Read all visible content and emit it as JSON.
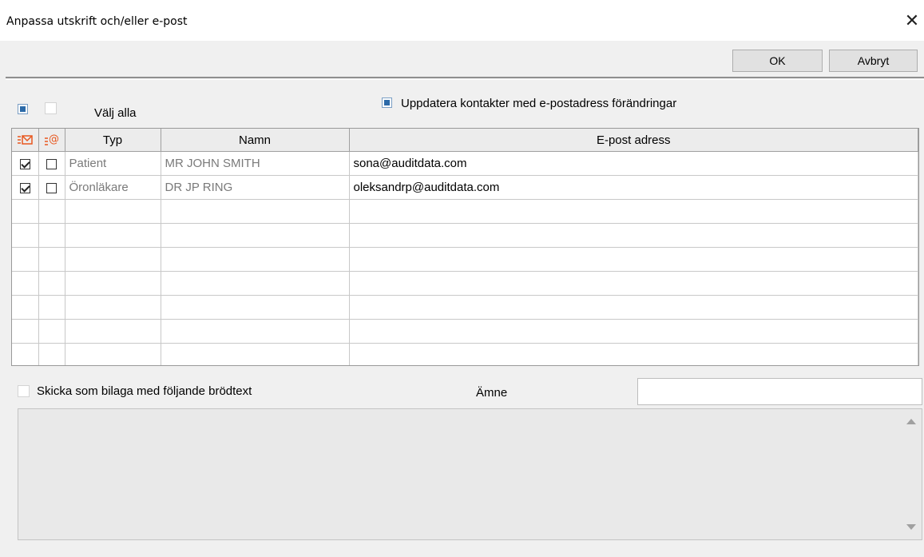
{
  "window": {
    "title": "Anpassa utskrift och/eller e-post",
    "close_glyph": "✕"
  },
  "toolbar": {
    "ok_label": "OK",
    "cancel_label": "Avbryt"
  },
  "options": {
    "select_all_label": "Välj alla",
    "update_contacts_label": "Uppdatera kontakter med e-postadress förändringar",
    "update_contacts_checked": true,
    "send_as_attachment_label": "Skicka som bilaga med följande brödtext",
    "send_as_attachment_checked": false,
    "subject_label": "Ämne",
    "subject_value": ""
  },
  "grid": {
    "columns": [
      {
        "name": "print-column",
        "label": "",
        "icon": "print-list-icon"
      },
      {
        "name": "email-column",
        "label": "",
        "icon": "email-at-icon"
      },
      {
        "name": "type-column",
        "label": "Typ"
      },
      {
        "name": "name-column",
        "label": "Namn"
      },
      {
        "name": "email-address-column",
        "label": "E-post adress"
      }
    ],
    "rows": [
      {
        "print": true,
        "email": false,
        "type": "Patient",
        "name": "MR JOHN SMITH",
        "email_address": "sona@auditdata.com"
      },
      {
        "print": true,
        "email": false,
        "type": "Öronläkare",
        "name": "DR JP RING",
        "email_address": "oleksandrp@auditdata.com"
      }
    ],
    "empty_rows": 7
  },
  "colors": {
    "accent": "#2c6aa8",
    "icon_orange": "#e8571e"
  }
}
